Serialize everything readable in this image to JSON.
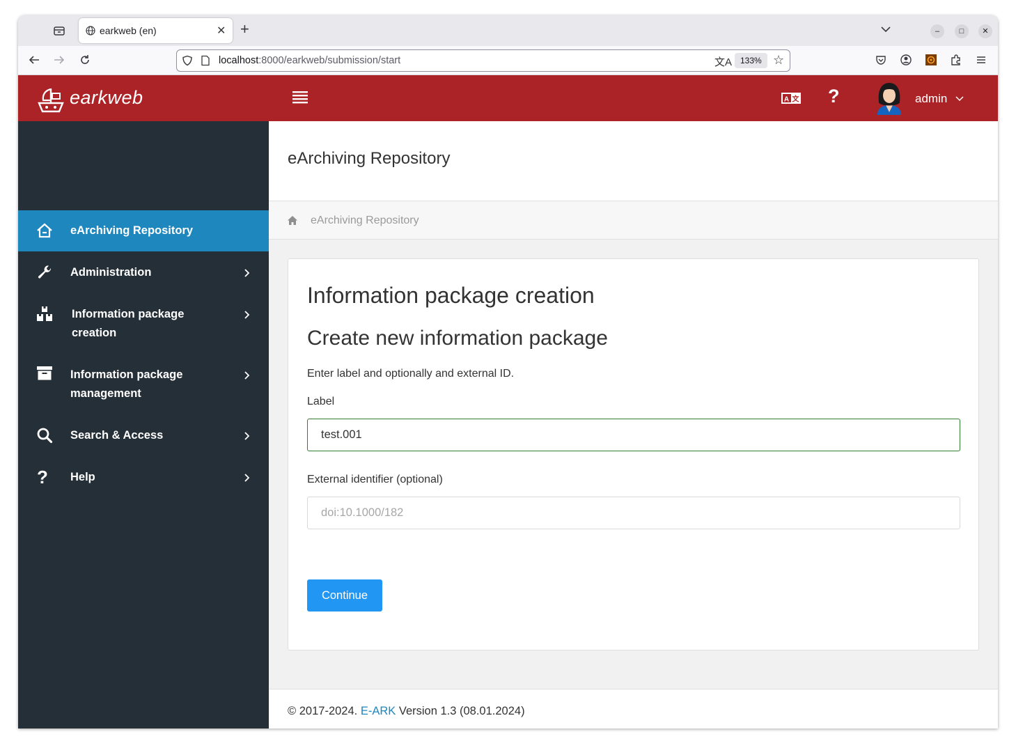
{
  "browser": {
    "tab_title": "earkweb (en)",
    "url_host": "localhost",
    "url_rest": ":8000/earkweb/submission/start",
    "zoom_level": "133%"
  },
  "app": {
    "logo_text": "earkweb",
    "user_name": "admin",
    "brand_color": "#ac2327"
  },
  "sidebar": {
    "items": [
      {
        "label": "eArchiving Repository",
        "icon": "home-icon",
        "active": true
      },
      {
        "label": "Administration",
        "icon": "wrench-icon"
      },
      {
        "label": "Information package creation",
        "icon": "boxes-icon"
      },
      {
        "label": "Information package management",
        "icon": "archive-box-icon"
      },
      {
        "label": "Search & Access",
        "icon": "search-icon"
      },
      {
        "label": "Help",
        "icon": "question-icon"
      }
    ]
  },
  "header": {
    "title": "eArchiving Repository"
  },
  "breadcrumb": {
    "home_label": "eArchiving Repository"
  },
  "form": {
    "heading": "Information package creation",
    "subheading": "Create new information package",
    "intro": "Enter label and optionally and external ID.",
    "label_field_label": "Label",
    "label_value": "test.001",
    "external_id_label": "External identifier (optional)",
    "external_id_placeholder": "doi:10.1000/182",
    "external_id_value": "",
    "continue_label": "Continue"
  },
  "footer": {
    "copyright": "© 2017-2024.",
    "link_text": "E-ARK",
    "version": "Version 1.3 (08.01.2024)"
  }
}
